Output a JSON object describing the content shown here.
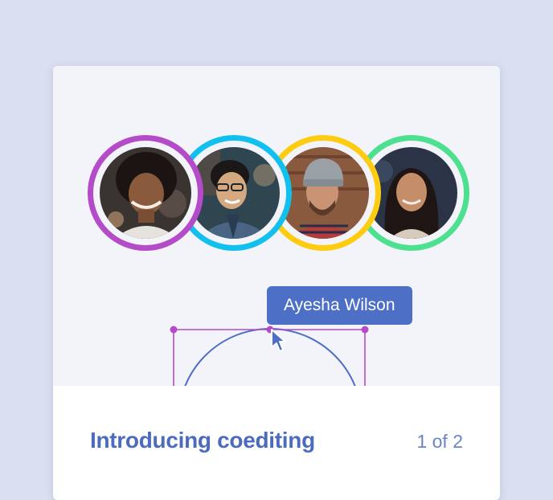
{
  "card": {
    "collaborators": [
      {
        "ring_color": "#b44bc8",
        "photo_icon": "person-curly-hair-icon"
      },
      {
        "ring_color": "#12c0f0",
        "photo_icon": "person-glasses-icon"
      },
      {
        "ring_color": "#ffcc12",
        "photo_icon": "person-beanie-icon"
      },
      {
        "ring_color": "#4de08f",
        "photo_icon": "person-long-hair-icon"
      }
    ],
    "tooltip": {
      "name": "Ayesha Wilson",
      "color": "#4e6fc6"
    },
    "selection_color": "#b44bc8",
    "shape_color": "#4e6fc6",
    "footer": {
      "title": "Introducing coediting",
      "pager": "1 of 2"
    }
  },
  "colors": {
    "background": "#dadff1",
    "card": "#f3f4fa",
    "accent": "#4c6bbd"
  }
}
